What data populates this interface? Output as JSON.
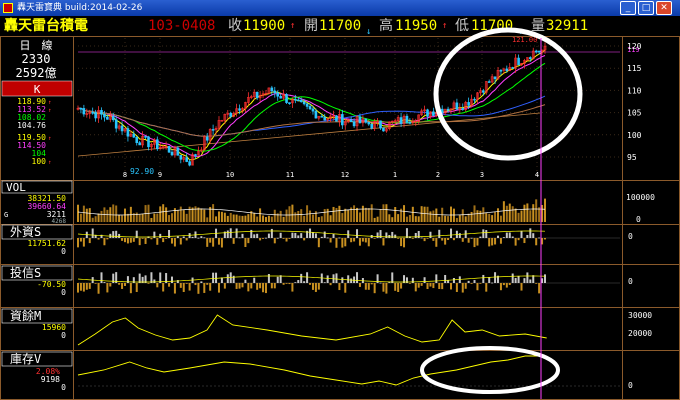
{
  "window": {
    "title": "轟天雷寶典 build:2014-02-26",
    "icon": "app-icon",
    "buttons": [
      "minimize-icon",
      "maximize-icon",
      "close-icon"
    ]
  },
  "quote": {
    "name": "轟天雷台積電",
    "date": "103-0408",
    "close_label": "收",
    "close_value": "11900",
    "open_label": "開",
    "open_value": "11700",
    "high_label": "高",
    "high_value": "11950",
    "low_label": "低",
    "low_value": "11700",
    "volume_label": "量",
    "volume_value": "32911"
  },
  "side": {
    "period": "日　線",
    "code": "2330",
    "cap": "2592億",
    "chart_mode": "K",
    "ma_values": [
      "118.90",
      "113.52",
      "108.02",
      "104.76"
    ],
    "ma_values2": [
      "119.50",
      "114.50",
      "104",
      "100"
    ],
    "vol_label": "VOL",
    "vol_values": [
      "38321.50",
      "39660.64",
      "3211"
    ],
    "vol_extra": "4268",
    "vol_left": "G",
    "foreign_label": "外資S",
    "foreign_value": "11751.62",
    "foreign_zero": "0",
    "trust_label": "投信S",
    "trust_value": "-70.50",
    "trust_zero": "0",
    "margin_label": "資餘M",
    "margin_value": "15960",
    "margin_zero": "0",
    "inventory_label": "庫存V",
    "inventory_value1": "2.08%",
    "inventory_value2": "9198",
    "inventory_zero": "0"
  },
  "main_chart": {
    "y_ticks": [
      "120",
      "115",
      "110",
      "105",
      "100",
      "95"
    ],
    "x_ticks": [
      "8",
      "9",
      "10",
      "11",
      "12",
      "1",
      "2",
      "3",
      "4"
    ],
    "low_label": "92.90",
    "high_label": "121.00",
    "current_label": "119"
  },
  "vol_chart": {
    "y_ticks": [
      "100000",
      "0"
    ]
  },
  "foreign_chart": {
    "y_ticks": [
      "0"
    ]
  },
  "trust_chart": {
    "y_ticks": [
      "0"
    ]
  },
  "margin_chart": {
    "y_ticks": [
      "30000",
      "20000"
    ]
  },
  "inventory_chart": {
    "y_ticks": [
      "0"
    ]
  },
  "colors": {
    "up": "#ff3030",
    "down": "#29c6ff",
    "frame": "#8b5a2b",
    "ma5": "#ffff00",
    "ma10": "#ff40ff",
    "ma20": "#00ff00",
    "ma60": "#3060ff",
    "ma120": "#b07040",
    "highlight": "#ffffff"
  }
}
